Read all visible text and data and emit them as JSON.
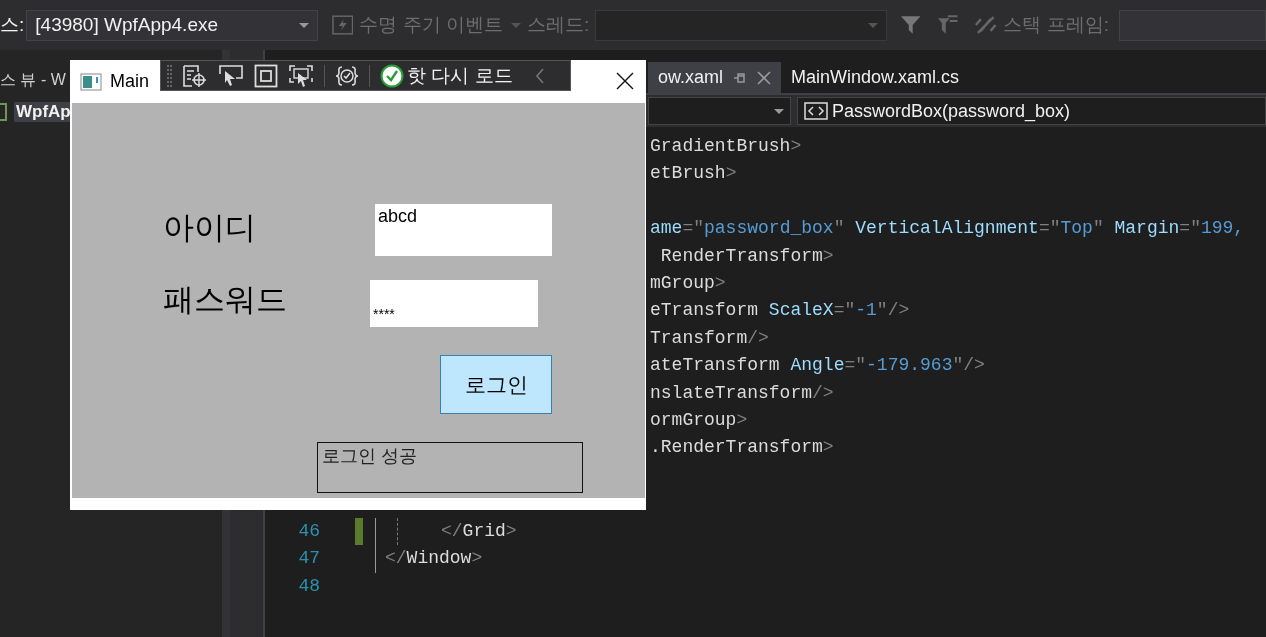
{
  "debug_toolbar": {
    "process_label": "스:",
    "process": "[43980] WpfApp4.exe",
    "lifecycle": "수명 주기 이벤트",
    "lifecycle_disabled": true,
    "thread_label": "스레드:",
    "thread_disabled": true,
    "stack_label": "스택 프레임:"
  },
  "solution_explorer": {
    "title": "스 뷰 - W",
    "items": [
      {
        "label": "WpfAp",
        "selected": true
      }
    ]
  },
  "doc_tabs": [
    {
      "label": "ow.xaml",
      "selected": true
    },
    {
      "label": "MainWindow.xaml.cs",
      "selected": false
    }
  ],
  "nav_bar": {
    "member": "PasswordBox(password_box)"
  },
  "editor": {
    "partial_lines": [
      [
        {
          "kind": "name",
          "t": "GradientBrush"
        },
        {
          "kind": "punct",
          "t": ">"
        }
      ],
      [
        {
          "kind": "name",
          "t": "etBrush"
        },
        {
          "kind": "punct",
          "t": ">"
        }
      ],
      [
        {
          "kind": "attr",
          "t": "ame"
        },
        {
          "kind": "punct",
          "t": "=\""
        },
        {
          "kind": "value",
          "t": "password_box"
        },
        {
          "kind": "punct",
          "t": "\" "
        },
        {
          "kind": "attr",
          "t": "VerticalAlignment"
        },
        {
          "kind": "punct",
          "t": "=\""
        },
        {
          "kind": "value",
          "t": "Top"
        },
        {
          "kind": "punct",
          "t": "\" "
        },
        {
          "kind": "attr",
          "t": "Margin"
        },
        {
          "kind": "punct",
          "t": "=\""
        },
        {
          "kind": "value",
          "t": "199,"
        }
      ],
      [
        {
          "kind": "name",
          "t": " RenderTransform"
        },
        {
          "kind": "punct",
          "t": ">"
        }
      ],
      [
        {
          "kind": "name",
          "t": "mGroup"
        },
        {
          "kind": "punct",
          "t": ">"
        }
      ],
      [
        {
          "kind": "name",
          "t": "eTransform "
        },
        {
          "kind": "attr",
          "t": "ScaleX"
        },
        {
          "kind": "punct",
          "t": "=\""
        },
        {
          "kind": "value",
          "t": "-1"
        },
        {
          "kind": "punct",
          "t": "\"/>"
        }
      ],
      [
        {
          "kind": "name",
          "t": "Transform"
        },
        {
          "kind": "punct",
          "t": "/>"
        }
      ],
      [
        {
          "kind": "name",
          "t": "ateTransform "
        },
        {
          "kind": "attr",
          "t": "Angle"
        },
        {
          "kind": "punct",
          "t": "=\""
        },
        {
          "kind": "value",
          "t": "-179.963"
        },
        {
          "kind": "punct",
          "t": "\"/>"
        }
      ],
      [
        {
          "kind": "name",
          "t": "nslateTransform"
        },
        {
          "kind": "punct",
          "t": "/>"
        }
      ],
      [
        {
          "kind": "name",
          "t": "ormGroup"
        },
        {
          "kind": "punct",
          "t": ">"
        }
      ],
      [
        {
          "kind": "name",
          "t": ".RenderTransform"
        },
        {
          "kind": "punct",
          "t": ">"
        }
      ]
    ],
    "lines": [
      {
        "number": "46",
        "changed": true,
        "segments": [
          {
            "kind": "punct",
            "t": "</"
          },
          {
            "kind": "name",
            "t": "Grid"
          },
          {
            "kind": "punct",
            "t": ">"
          }
        ]
      },
      {
        "number": "47",
        "changed": false,
        "segments": [
          {
            "kind": "punct",
            "t": "</"
          },
          {
            "kind": "name",
            "t": "Window"
          },
          {
            "kind": "punct",
            "t": ">"
          }
        ]
      },
      {
        "number": "48",
        "changed": false
      }
    ]
  },
  "app_window": {
    "title": "Main",
    "hot_reload": "핫 다시 로드",
    "id_label": "아이디",
    "id_value": "abcd",
    "password_label": "패스워드",
    "password_value": "****",
    "login_button": "로그인",
    "status": "로그인 성공"
  }
}
